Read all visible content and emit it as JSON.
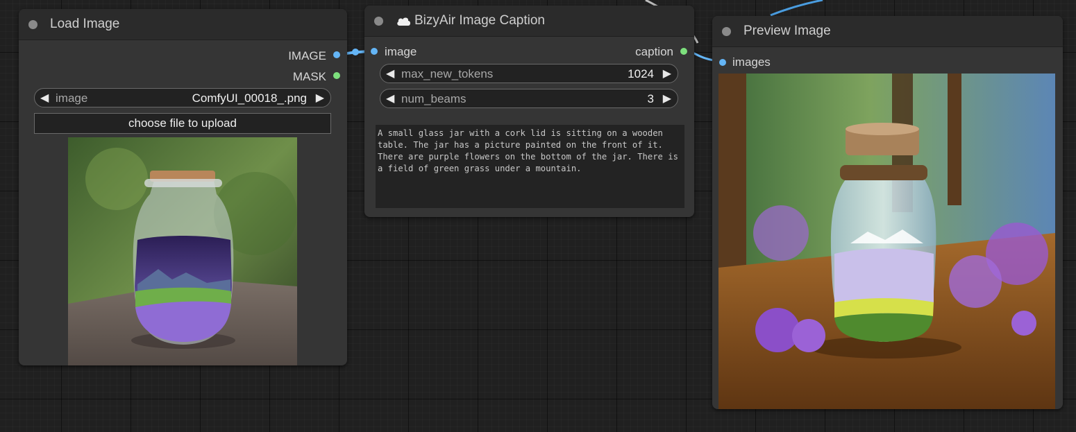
{
  "nodes": {
    "load_image": {
      "title": "Load Image",
      "outputs": {
        "image": "IMAGE",
        "mask": "MASK"
      },
      "image_widget": {
        "name": "image",
        "value": "ComfyUI_00018_.png"
      },
      "upload_button": "choose file to upload"
    },
    "caption": {
      "title": "BizyAir Image Caption",
      "title_icon": "cloud-icon",
      "input": "image",
      "output": "caption",
      "max_tokens": {
        "name": "max_new_tokens",
        "value": "1024"
      },
      "num_beams": {
        "name": "num_beams",
        "value": "3"
      },
      "text": "A small glass jar with a cork lid is sitting on a wooden table. The jar has a picture painted on the front of it. There are purple flowers on the bottom of the jar. There is a field of green grass under a mountain."
    },
    "preview": {
      "title": "Preview Image",
      "input": "images"
    }
  },
  "colors": {
    "image_link": "#64b5f6",
    "mask_slot": "#7de07d",
    "canvas": "#202020",
    "node_body": "#353535",
    "node_title": "#2b2b2b"
  },
  "icons": {
    "arrow_left": "◀",
    "arrow_right": "▶",
    "cloud": "cloud-icon"
  }
}
